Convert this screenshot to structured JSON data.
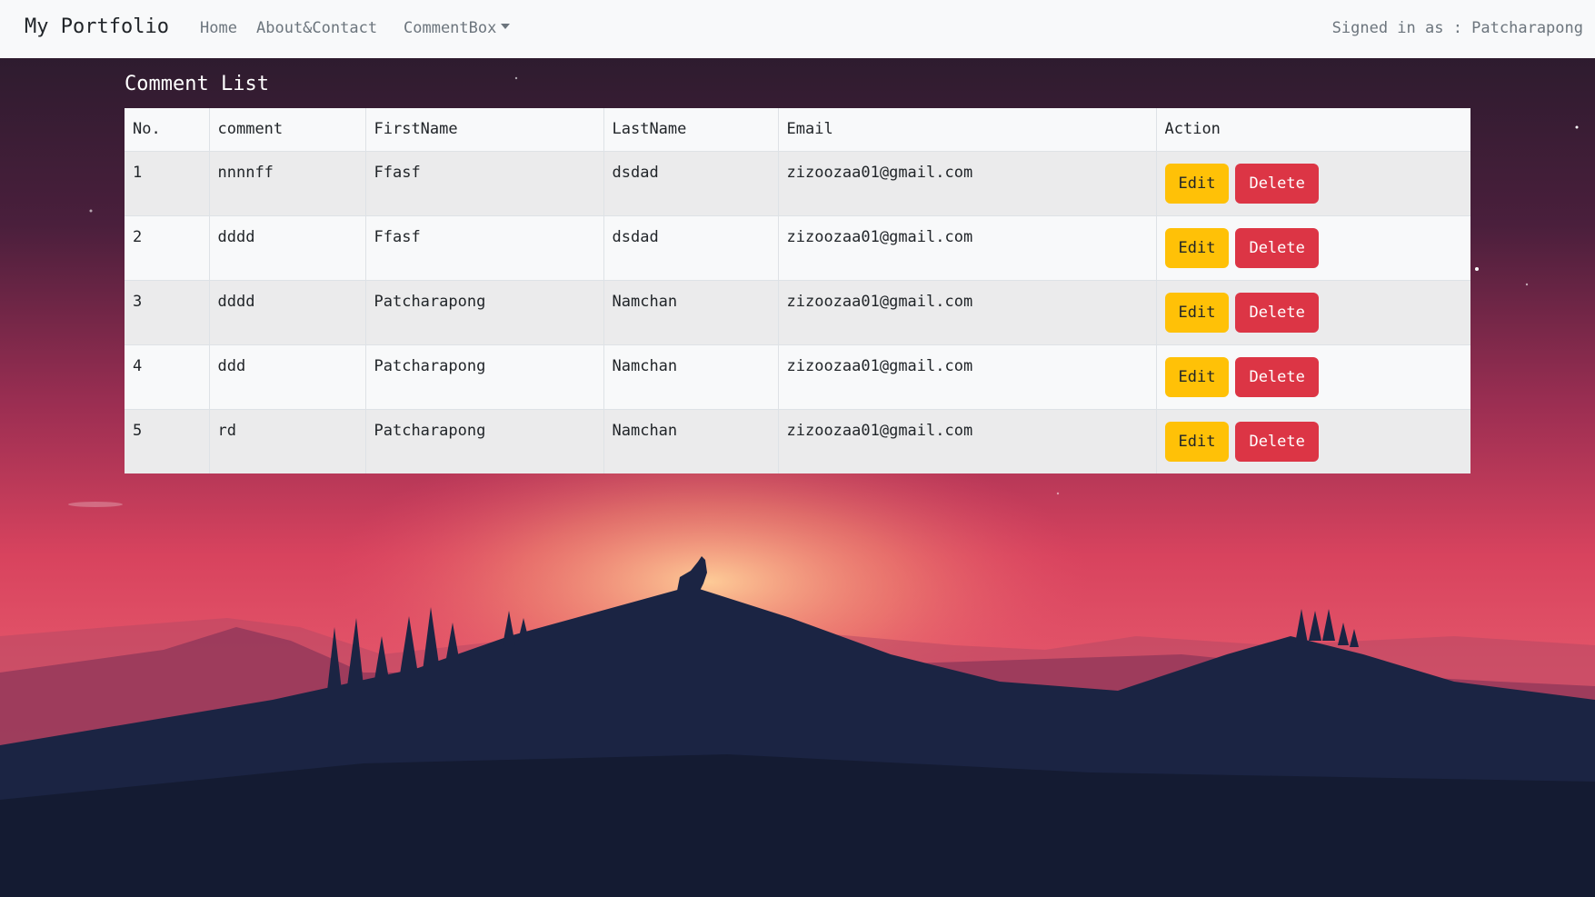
{
  "navbar": {
    "brand": "My Portfolio",
    "links": [
      "Home",
      "About&Contact",
      "CommentBox"
    ],
    "signed_in_text": "Signed in as : Patcharapong"
  },
  "page": {
    "title": "Comment List"
  },
  "table": {
    "headers": [
      "No.",
      "comment",
      "FirstName",
      "LastName",
      "Email",
      "Action"
    ],
    "rows": [
      {
        "no": "1",
        "comment": "nnnnff",
        "first": "Ffasf",
        "last": "dsdad",
        "email": "zizoozaa01@gmail.com"
      },
      {
        "no": "2",
        "comment": "dddd",
        "first": "Ffasf",
        "last": "dsdad",
        "email": "zizoozaa01@gmail.com"
      },
      {
        "no": "3",
        "comment": "dddd",
        "first": "Patcharapong",
        "last": "Namchan",
        "email": "zizoozaa01@gmail.com"
      },
      {
        "no": "4",
        "comment": "ddd",
        "first": "Patcharapong",
        "last": "Namchan",
        "email": "zizoozaa01@gmail.com"
      },
      {
        "no": "5",
        "comment": "rd",
        "first": "Patcharapong",
        "last": "Namchan",
        "email": "zizoozaa01@gmail.com"
      }
    ],
    "edit_label": "Edit",
    "delete_label": "Delete"
  },
  "colors": {
    "navbar_bg": "#f8f9fa",
    "edit_button": "#ffc107",
    "delete_button": "#dc3545",
    "sky_top": "#251a2c",
    "sky_horizon": "#f7a97a",
    "mountain": "#1a2342"
  }
}
